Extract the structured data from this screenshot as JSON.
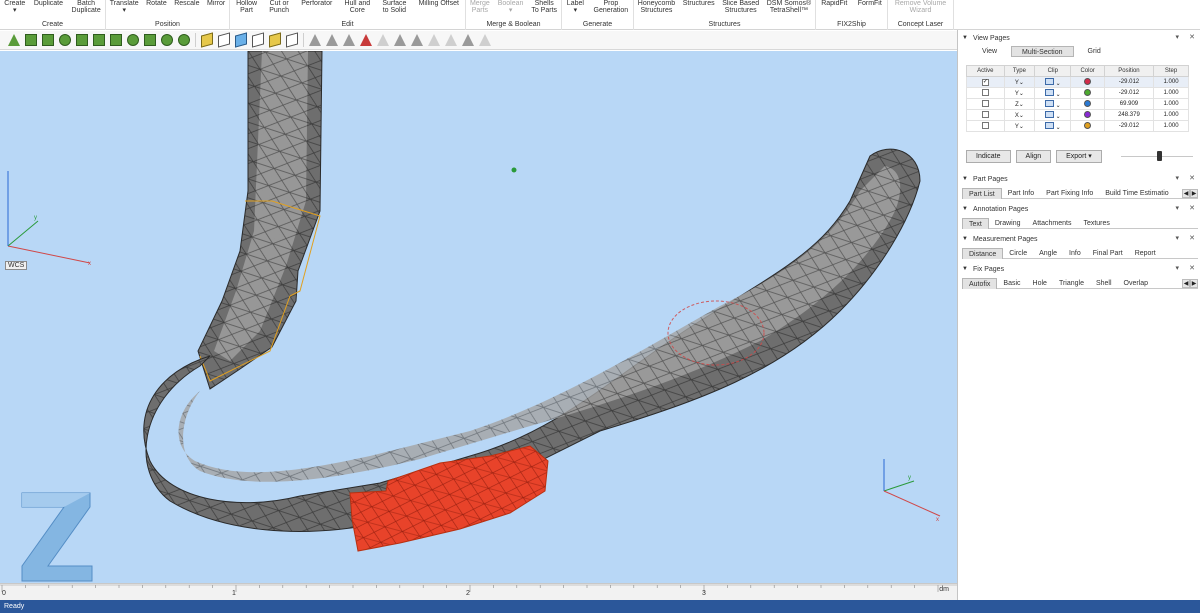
{
  "ribbon": {
    "groups": [
      {
        "label": "Create",
        "buttons": [
          {
            "text": "Create\n▾",
            "enabled": true
          },
          {
            "text": "Duplicate",
            "enabled": true
          },
          {
            "text": "Batch\nDuplicate",
            "enabled": true
          }
        ]
      },
      {
        "label": "Position",
        "buttons": [
          {
            "text": "Translate\n▾",
            "enabled": true
          },
          {
            "text": "Rotate",
            "enabled": true
          },
          {
            "text": "Rescale",
            "enabled": true
          },
          {
            "text": "Mirror",
            "enabled": true
          }
        ]
      },
      {
        "label": "Edit",
        "buttons": [
          {
            "text": "Hollow\nPart",
            "enabled": true
          },
          {
            "text": "Cut or\nPunch",
            "enabled": true
          },
          {
            "text": "Perforator",
            "enabled": true
          },
          {
            "text": "Hull and\nCore",
            "enabled": true
          },
          {
            "text": "Surface\nto Solid",
            "enabled": true
          },
          {
            "text": "Milling Offset",
            "enabled": true
          }
        ]
      },
      {
        "label": "Merge & Boolean",
        "buttons": [
          {
            "text": "Merge\nParts",
            "enabled": false
          },
          {
            "text": "Boolean\n▾",
            "enabled": false
          },
          {
            "text": "Shells\nTo Parts",
            "enabled": true
          }
        ]
      },
      {
        "label": "Generate",
        "buttons": [
          {
            "text": "Label\n▾",
            "enabled": true
          },
          {
            "text": "Prop\nGeneration",
            "enabled": true
          }
        ]
      },
      {
        "label": "Structures",
        "buttons": [
          {
            "text": "Honeycomb\nStructures",
            "enabled": true
          },
          {
            "text": "Structures",
            "enabled": true
          },
          {
            "text": "Slice Based\nStructures",
            "enabled": true
          },
          {
            "text": "DSM Somos®\nTetraShell™",
            "enabled": true
          }
        ]
      },
      {
        "label": "FIX2Ship",
        "buttons": [
          {
            "text": "RapidFit",
            "enabled": true
          },
          {
            "text": "FormFit",
            "enabled": true
          }
        ]
      },
      {
        "label": "Concept Laser",
        "buttons": [
          {
            "text": "Remove Volume\nWizard",
            "enabled": false
          }
        ]
      }
    ]
  },
  "toolbar": {
    "tools": [
      {
        "icon": "triangle-icon",
        "style": "t-tri"
      },
      {
        "icon": "plane-cut-icon",
        "style": ""
      },
      {
        "icon": "surface-select-icon",
        "style": ""
      },
      {
        "icon": "shell-select-icon",
        "style": "t-round"
      },
      {
        "icon": "box-select-icon",
        "style": ""
      },
      {
        "icon": "wave-select-icon",
        "style": ""
      },
      {
        "icon": "brush-select-icon",
        "style": ""
      },
      {
        "icon": "lasso-select-icon",
        "style": "t-round"
      },
      {
        "icon": "grow-select-icon",
        "style": ""
      },
      {
        "icon": "shrink-select-icon",
        "style": "t-round"
      },
      {
        "icon": "invert-select-icon",
        "style": "t-round"
      },
      {
        "icon": "sep",
        "style": "sep"
      },
      {
        "icon": "cube-yellow-icon",
        "style": "t-cube"
      },
      {
        "icon": "cube-white-icon",
        "style": "t-cube2"
      },
      {
        "icon": "cube-blue-icon",
        "style": "t-cube3"
      },
      {
        "icon": "cube-outline-icon",
        "style": "t-cube2"
      },
      {
        "icon": "cube-multi-icon",
        "style": "t-cube"
      },
      {
        "icon": "cube-small-icon",
        "style": "t-cube2"
      },
      {
        "icon": "sep",
        "style": "sep"
      },
      {
        "icon": "triangle-grey-icon",
        "style": "t-grey"
      },
      {
        "icon": "triangle-mark-icon",
        "style": "t-grey"
      },
      {
        "icon": "triangle-small-icon",
        "style": "t-grey"
      },
      {
        "icon": "triangle-red-icon",
        "style": "t-red"
      },
      {
        "icon": "triangle-wire-icon",
        "style": "t-wire"
      },
      {
        "icon": "triangle-solid-icon",
        "style": "t-grey"
      },
      {
        "icon": "triangle-shaded-icon",
        "style": "t-grey"
      },
      {
        "icon": "triangle-edge-icon",
        "style": "t-wire"
      },
      {
        "icon": "triangle-light-icon",
        "style": "t-wire"
      },
      {
        "icon": "triangle-blue-icon",
        "style": "t-grey"
      },
      {
        "icon": "triangle-flat-icon",
        "style": "t-wire"
      }
    ]
  },
  "viewport": {
    "wcs_label": "WCS",
    "background": "#b8d7f6",
    "mesh_color": "#5b5b5b",
    "highlight_color": "#e8432a"
  },
  "ruler": {
    "labels": [
      "0",
      "1",
      "2",
      "3"
    ],
    "unit": "dm"
  },
  "status": {
    "text": "Ready"
  },
  "panel": {
    "view_pages": {
      "title": "View Pages",
      "tabs": [
        "View",
        "Multi-Section",
        "Grid"
      ],
      "active_tab": "Multi-Section",
      "columns": [
        "Active",
        "Type",
        "Clip",
        "Color",
        "Position",
        "Step"
      ],
      "rows": [
        {
          "active": true,
          "type": "Y⌄",
          "color": "#d42a4a",
          "position": "-29.012",
          "step": "1.000"
        },
        {
          "active": false,
          "type": "Y⌄",
          "color": "#4caa2e",
          "position": "-29.012",
          "step": "1.000"
        },
        {
          "active": false,
          "type": "Z⌄",
          "color": "#2a7ad4",
          "position": "69.909",
          "step": "1.000"
        },
        {
          "active": false,
          "type": "X⌄",
          "color": "#8a2ad4",
          "position": "248.379",
          "step": "1.000"
        },
        {
          "active": false,
          "type": "Y⌄",
          "color": "#e0a020",
          "position": "-29.012",
          "step": "1.000"
        }
      ],
      "buttons": [
        "Indicate",
        "Align",
        "Export ▾"
      ]
    },
    "part_pages": {
      "title": "Part Pages",
      "tabs": [
        "Part List",
        "Part Info",
        "Part Fixing Info",
        "Build Time Estimatio"
      ],
      "active_tab": "Part List"
    },
    "annotation_pages": {
      "title": "Annotation Pages",
      "tabs": [
        "Text",
        "Drawing",
        "Attachments",
        "Textures"
      ],
      "active_tab": "Text"
    },
    "measurement_pages": {
      "title": "Measurement Pages",
      "tabs": [
        "Distance",
        "Circle",
        "Angle",
        "Info",
        "Final Part",
        "Report"
      ],
      "active_tab": "Distance"
    },
    "fix_pages": {
      "title": "Fix Pages",
      "tabs": [
        "Autofix",
        "Basic",
        "Hole",
        "Triangle",
        "Shell",
        "Overlap"
      ],
      "active_tab": "Autofix"
    }
  }
}
